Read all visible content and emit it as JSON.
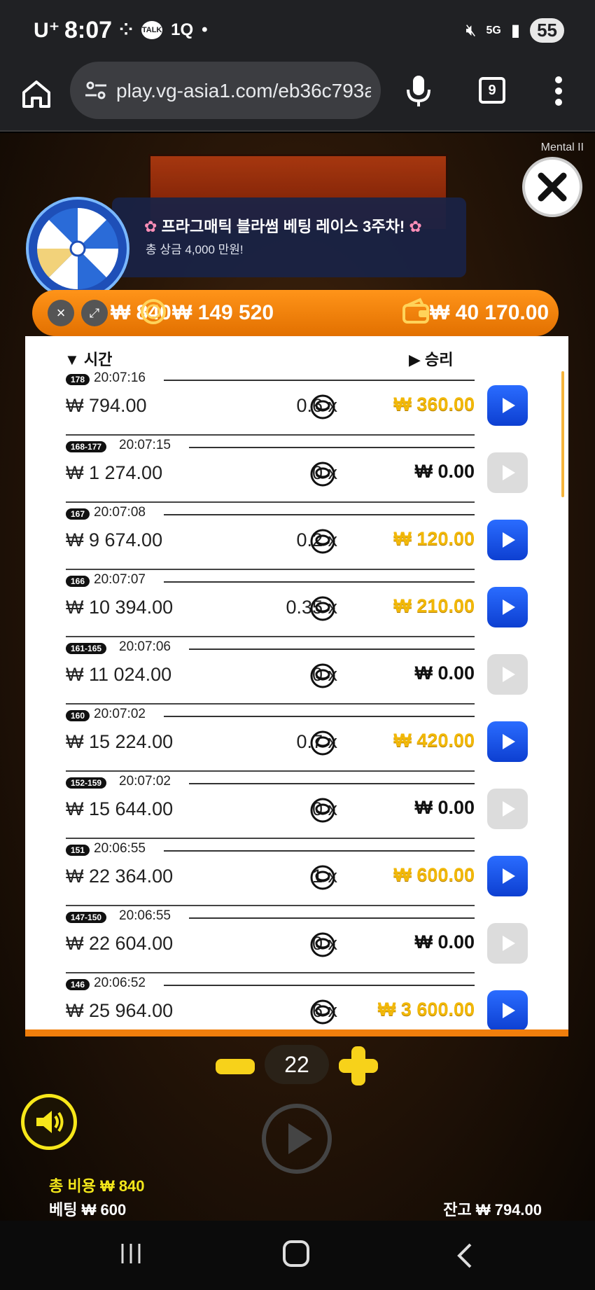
{
  "status_bar": {
    "carrier": "U⁺",
    "time": "8:07",
    "badge": "1Q",
    "talk": "TALK",
    "network": "5G",
    "battery": "55"
  },
  "browser": {
    "url": "play.vg-asia1.com/eb36c793a5",
    "tab_count": "9"
  },
  "game": {
    "corner_label": "Mental II",
    "promo": {
      "title": "프라그매틱 블라썸 베팅 레이스 3주차!",
      "subtitle": "총 상금 4,000 만원!"
    },
    "top_bar": {
      "stake": "₩ 840",
      "coins": "₩ 149 520",
      "balance": "₩ 40 170.00"
    },
    "history": {
      "col_time": "시간",
      "col_win": "승리",
      "rows": [
        {
          "tag": "178",
          "time": "20:07:16",
          "bet": "₩ 794.00",
          "mult": "0.6 x",
          "win": "₩ 360.00",
          "positive": true
        },
        {
          "tag": "168-177",
          "time": "20:07:15",
          "bet": "₩ 1 274.00",
          "mult": "0 x",
          "win": "₩ 0.00",
          "positive": false
        },
        {
          "tag": "167",
          "time": "20:07:08",
          "bet": "₩ 9 674.00",
          "mult": "0.2 x",
          "win": "₩ 120.00",
          "positive": true
        },
        {
          "tag": "166",
          "time": "20:07:07",
          "bet": "₩ 10 394.00",
          "mult": "0.35 x",
          "win": "₩ 210.00",
          "positive": true
        },
        {
          "tag": "161-165",
          "time": "20:07:06",
          "bet": "₩ 11 024.00",
          "mult": "0 x",
          "win": "₩ 0.00",
          "positive": false
        },
        {
          "tag": "160",
          "time": "20:07:02",
          "bet": "₩ 15 224.00",
          "mult": "0.7 x",
          "win": "₩ 420.00",
          "positive": true
        },
        {
          "tag": "152-159",
          "time": "20:07:02",
          "bet": "₩ 15 644.00",
          "mult": "0 x",
          "win": "₩ 0.00",
          "positive": false
        },
        {
          "tag": "151",
          "time": "20:06:55",
          "bet": "₩ 22 364.00",
          "mult": "1 x",
          "win": "₩ 600.00",
          "positive": true
        },
        {
          "tag": "147-150",
          "time": "20:06:55",
          "bet": "₩ 22 604.00",
          "mult": "0 x",
          "win": "₩ 0.00",
          "positive": false
        },
        {
          "tag": "146",
          "time": "20:06:52",
          "bet": "₩ 25 964.00",
          "mult": "6 x",
          "win": "₩ 3 600.00",
          "positive": true
        }
      ]
    },
    "controls": {
      "count": "22",
      "total_cost": "총 비용  ₩ 840",
      "bet": "베팅  ₩ 600",
      "balance": "잔고  ₩ 794.00"
    }
  },
  "colors": {
    "orange": "#f07e0c",
    "gold": "#f2b807",
    "blue": "#1a55e8",
    "yellow": "#f7e71a"
  }
}
